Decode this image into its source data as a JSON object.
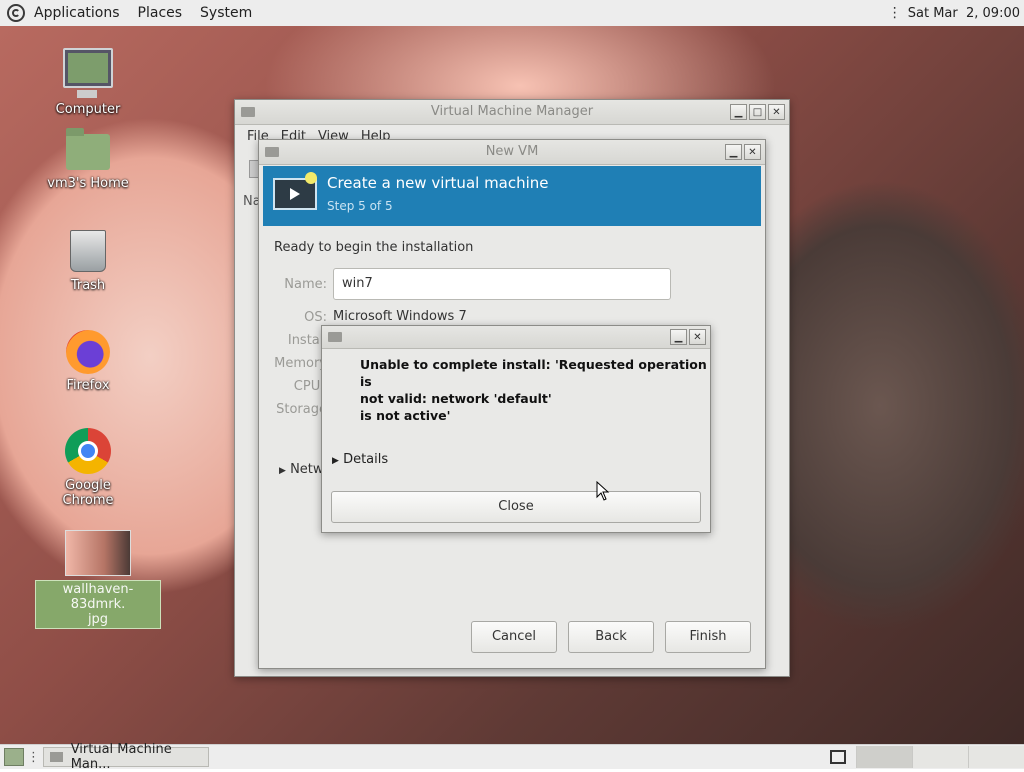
{
  "top_panel": {
    "menus": [
      "Applications",
      "Places",
      "System"
    ],
    "clock": "Sat Mar  2, 09:00"
  },
  "desktop_icons": [
    {
      "label": "Computer",
      "icon": "computer-icon"
    },
    {
      "label": "vm3's Home",
      "icon": "home-folder-icon"
    },
    {
      "label": "Trash",
      "icon": "trash-icon"
    },
    {
      "label": "Firefox",
      "icon": "firefox-icon"
    },
    {
      "label": "Google Chrome",
      "icon": "chrome-icon"
    },
    {
      "label": "wallhaven-83dmrk.\njpg",
      "icon": "image-file-icon"
    }
  ],
  "vmm_window": {
    "title": "Virtual Machine Manager",
    "menus": [
      "File",
      "Edit",
      "View",
      "Help"
    ],
    "partial_label": "Na"
  },
  "newvm_window": {
    "title": "New VM",
    "header_title": "Create a new virtual machine",
    "header_step": "Step 5 of 5",
    "ready_text": "Ready to begin the installation",
    "name_label": "Name:",
    "name_value": "win7",
    "os_label": "OS:",
    "os_value": "Microsoft Windows 7",
    "install_label": "Install",
    "memory_label": "Memory",
    "cpus_label": "CPUs",
    "storage_label": "Storage",
    "network_label": "Netw",
    "buttons": {
      "cancel": "Cancel",
      "back": "Back",
      "finish": "Finish"
    }
  },
  "error_dialog": {
    "message_line1": "Unable to complete install: 'Requested operation is",
    "message_line2": "not valid: network 'default'",
    "message_line3": "is not active'",
    "details_label": "Details",
    "close_label": "Close"
  },
  "taskbar": {
    "task_label": "Virtual Machine Man..."
  }
}
